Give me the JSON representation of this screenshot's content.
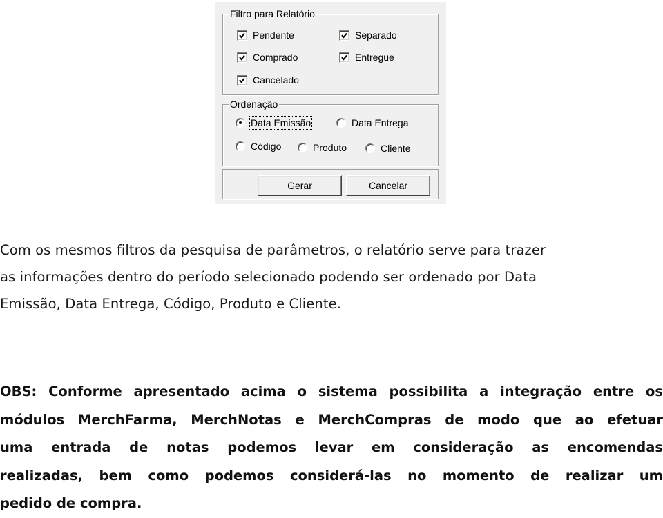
{
  "dialog": {
    "filter_group": {
      "title": "Filtro para Relatório",
      "checkboxes": [
        {
          "label": "Pendente",
          "checked": true
        },
        {
          "label": "Separado",
          "checked": true
        },
        {
          "label": "Comprado",
          "checked": true
        },
        {
          "label": "Entregue",
          "checked": true
        },
        {
          "label": "Cancelado",
          "checked": true
        }
      ]
    },
    "order_group": {
      "title": "Ordenação",
      "options": [
        {
          "label": "Data Emissão",
          "selected": true
        },
        {
          "label": "Data Entrega",
          "selected": false
        },
        {
          "label": "Código",
          "selected": false
        },
        {
          "label": "Produto",
          "selected": false
        },
        {
          "label": "Cliente",
          "selected": false
        }
      ]
    },
    "buttons": {
      "gerar_accel": "G",
      "gerar_rest": "erar",
      "cancelar_accel": "C",
      "cancelar_rest": "ancelar"
    }
  },
  "text": {
    "paragraph1": [
      "Com os mesmos filtros da pesquisa de parâmetros, o relatório serve para trazer",
      "as informações dentro do período selecionado podendo ser ordenado por Data",
      "Emissão, Data Entrega, Código, Produto e Cliente."
    ],
    "paragraph2": [
      "OBS: Conforme apresentado acima o sistema possibilita a integração entre os",
      "módulos MerchFarma, MerchNotas e MerchCompras de modo que ao efetuar",
      "uma entrada de notas podemos levar em consideração as encomendas",
      "realizadas, bem como podemos considerá-las no momento de realizar um",
      "pedido de compra."
    ]
  }
}
